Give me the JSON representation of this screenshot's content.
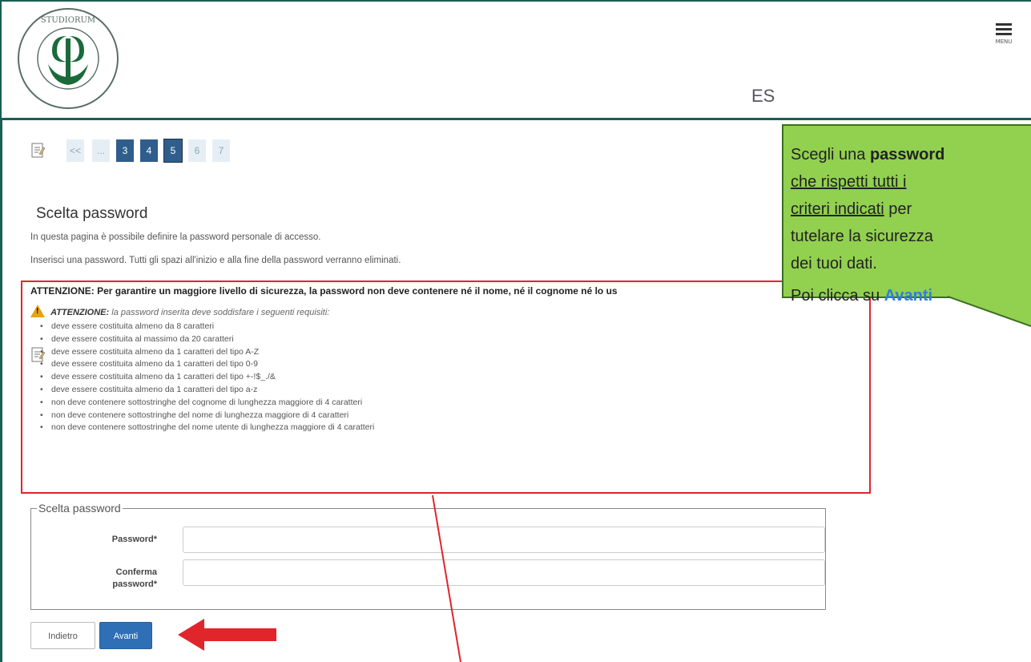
{
  "header": {
    "logo_alt": "UNIVERSITAS STUDIORUM INSUBRIAE",
    "menu_label": "MENU",
    "page_heading_partial": "ES"
  },
  "pager": {
    "items": [
      "<<",
      "...",
      "3",
      "4",
      "5",
      "6",
      "7"
    ],
    "active": "5"
  },
  "page": {
    "title": "Scelta password",
    "intro1": "In questa pagina è possibile definire la password personale di accesso.",
    "intro2": "Inserisci una password. Tutti gli spazi all'inizio e alla fine della password verranno eliminati.",
    "attention": "ATTENZIONE: Per garantire un maggiore livello di sicurezza, la password non deve contenere né il nome, né il cognome né lo us",
    "warn_bold": "ATTENZIONE:",
    "warn_text": " la password inserita deve soddisfare i seguenti requisiti:",
    "requirements": [
      "deve essere costituita almeno da 8 caratteri",
      "deve essere costituita al massimo da 20 caratteri",
      "deve essere costituita almeno da 1 caratteri del tipo A-Z",
      "deve essere costituita almeno da 1 caratteri del tipo 0-9",
      "deve essere costituita almeno da 1 caratteri del tipo +-!$_./&",
      "deve essere costituita almeno da 1 caratteri del tipo a-z",
      "non deve contenere sottostringhe del cognome di lunghezza maggiore di 4 caratteri",
      "non deve contenere sottostringhe del nome di lunghezza maggiore di 4 caratteri",
      "non deve contenere sottostringhe del nome utente di lunghezza maggiore di 4 caratteri"
    ]
  },
  "form": {
    "legend": "Scelta password",
    "password_label": "Password*",
    "confirm_label_1": "Conferma",
    "confirm_label_2": "password*",
    "password_value": "",
    "confirm_value": ""
  },
  "buttons": {
    "back": "Indietro",
    "next": "Avanti"
  },
  "callout": {
    "line1_pre": "Scegli una ",
    "line1_bold": "password",
    "line2": "che rispetti tutti i",
    "line3_u": "criteri indicati",
    "line3_post": " per",
    "line4": "tutelare la sicurezza",
    "line5": "dei tuoi dati.",
    "line6_pre": "Poi clicca su ",
    "line6_link": "Avanti"
  },
  "colors": {
    "frame": "#1b5e55",
    "callout_bg": "#92d050",
    "highlight_red": "#e0252b",
    "button_blue": "#2f6fb5"
  }
}
